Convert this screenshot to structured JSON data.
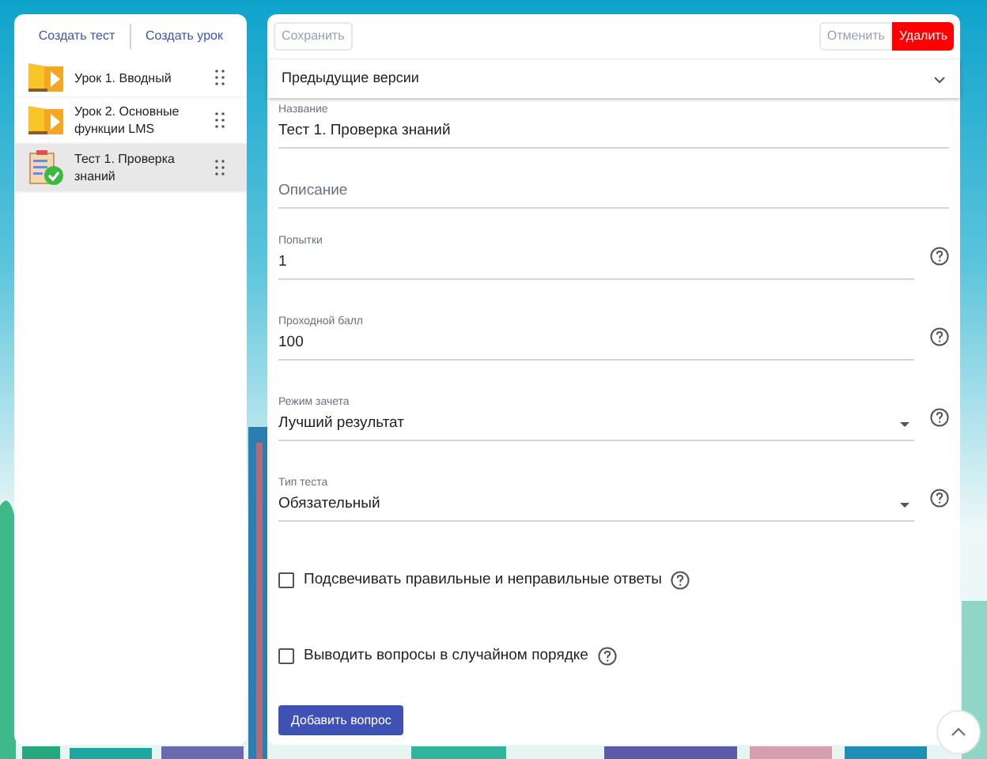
{
  "sidebar": {
    "actions": [
      "Создать тест",
      "Создать урок"
    ],
    "items": [
      {
        "kind": "lesson",
        "label": "Урок 1. Вводный",
        "selected": false
      },
      {
        "kind": "lesson",
        "label": "Урок 2. Основные функции LMS",
        "selected": false
      },
      {
        "kind": "test",
        "label": "Тест 1. Проверка знаний",
        "selected": true
      }
    ]
  },
  "toolbar": {
    "save": {
      "label": "Сохранить",
      "disabled": true
    },
    "cancel": {
      "label": "Отменить",
      "disabled": true
    },
    "delete": {
      "label": "Удалить"
    }
  },
  "versions": {
    "label": "Предыдущие версии",
    "expanded": false
  },
  "fields": [
    {
      "kind": "text",
      "label": "Название",
      "value": "Тест 1. Проверка знаний",
      "help": false
    },
    {
      "kind": "text",
      "placeholder": "Описание",
      "help": false
    },
    {
      "kind": "text",
      "label": "Попытки",
      "value": "1",
      "help": true
    },
    {
      "kind": "text",
      "label": "Проходной балл",
      "value": "100",
      "help": true
    },
    {
      "kind": "select",
      "label": "Режим зачета",
      "value": "Лучший результат",
      "help": true
    },
    {
      "kind": "select",
      "label": "Тип теста",
      "value": "Обязательный",
      "help": true
    }
  ],
  "options": [
    {
      "label": "Подсвечивать правильные и неправильные ответы",
      "checked": false
    },
    {
      "label": "Выводить вопросы в случайном порядке",
      "checked": false
    }
  ],
  "add_button": "Добавить вопрос"
}
